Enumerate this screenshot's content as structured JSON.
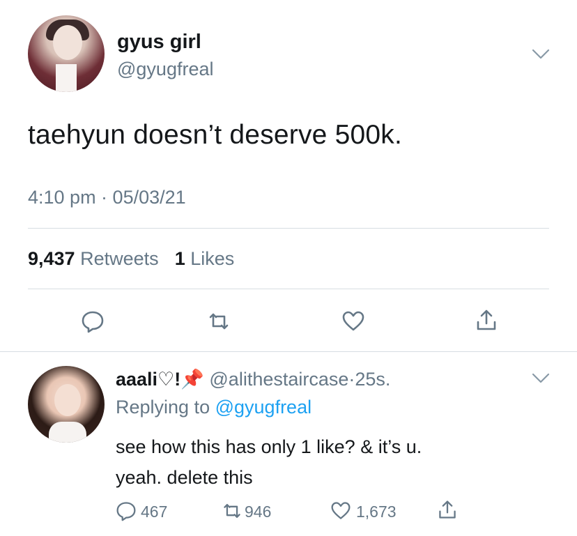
{
  "tweet": {
    "display_name": "gyus girl",
    "handle": "@gyugfreal",
    "text": "taehyun doesn’t deserve 500k.",
    "timestamp": "4:10 pm · 05/03/21",
    "retweets_count": "9,437",
    "retweets_label": "Retweets",
    "likes_count": "1",
    "likes_label": "Likes",
    "menu_icon": "chevron-down-icon",
    "actions": [
      "reply-icon",
      "retweet-icon",
      "like-icon",
      "share-icon"
    ]
  },
  "reply": {
    "display_name": "aaali♡!",
    "emoji": "📌",
    "handle": "@alithestaircase",
    "separator": "·",
    "time": "25s.",
    "replying_label": "Replying to",
    "replying_to": "@gyugfreal",
    "text_line1": "see how this has only 1 like? & it’s u.",
    "text_line2": "yeah. delete this",
    "reply_count": "467",
    "retweet_count": "946",
    "like_count": "1,673",
    "menu_icon": "chevron-down-icon"
  },
  "colors": {
    "primary_text": "#14171a",
    "secondary_text": "#657786",
    "link": "#1da1f2",
    "divider": "#d7dde2"
  }
}
